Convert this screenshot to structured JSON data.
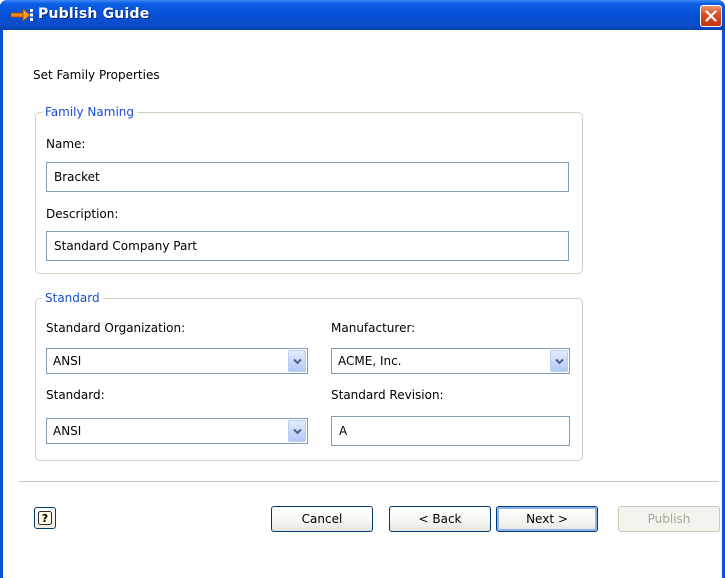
{
  "window": {
    "title": "Publish Guide",
    "icons": {
      "app": "publish-arrow-icon",
      "close": "close-icon"
    }
  },
  "page": {
    "heading": "Set Family Properties"
  },
  "family_naming": {
    "legend": "Family Naming",
    "name_label": "Name:",
    "name_value": "Bracket",
    "description_label": "Description:",
    "description_value": "Standard Company Part"
  },
  "standard": {
    "legend": "Standard",
    "org_label": "Standard Organization:",
    "org_value": "ANSI",
    "manufacturer_label": "Manufacturer:",
    "manufacturer_value": "ACME, Inc.",
    "standard_label": "Standard:",
    "standard_value": "ANSI",
    "revision_label": "Standard Revision:",
    "revision_value": "A"
  },
  "buttons": {
    "help_icon": "help-icon",
    "cancel": "Cancel",
    "back": "< Back",
    "next": "Next >",
    "publish": "Publish"
  },
  "colors": {
    "titlebar": "#0650d6",
    "legend_text": "#1a4fd0",
    "close_button": "#d84a22"
  }
}
